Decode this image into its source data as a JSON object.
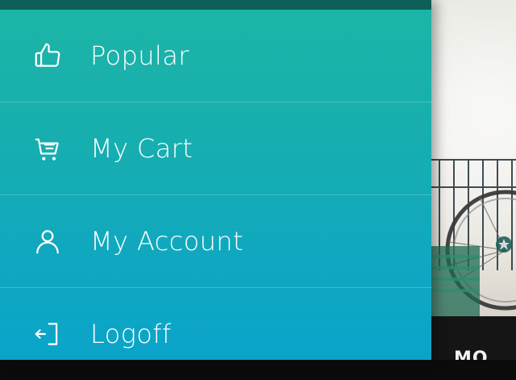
{
  "menu": {
    "items": [
      {
        "label": "Popular",
        "icon": "thumbs-up-icon"
      },
      {
        "label": "My Cart",
        "icon": "cart-icon"
      },
      {
        "label": "My Account",
        "icon": "user-icon"
      },
      {
        "label": "Logoff",
        "icon": "logoff-icon"
      }
    ]
  },
  "background": {
    "peek_text": "MO"
  },
  "colors": {
    "drawer_top": "#1db5a5",
    "drawer_bottom": "#0aa4c9",
    "drawer_header": "#0d5f57",
    "text": "#ffffff"
  }
}
